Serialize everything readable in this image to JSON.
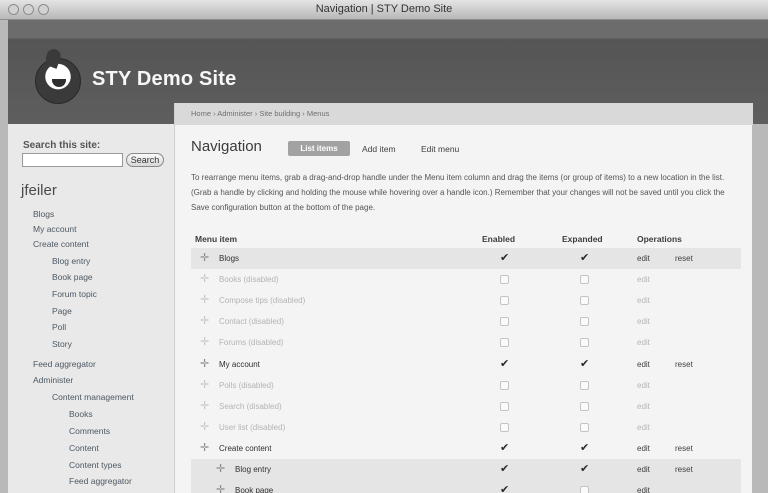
{
  "window": {
    "title": "Navigation | STY Demo Site"
  },
  "header": {
    "site_name": "STY Demo Site"
  },
  "sidebar": {
    "search_label": "Search this site:",
    "search_value": "",
    "search_button": "Search",
    "username": "jfeiler",
    "links": [
      "Blogs",
      "My account",
      "Create content",
      "Blog entry",
      "Book page",
      "Forum topic",
      "Page",
      "Poll",
      "Story",
      "Feed aggregator",
      "Administer",
      "Content management",
      "Books",
      "Comments",
      "Content",
      "Content types",
      "Feed aggregator"
    ]
  },
  "main": {
    "breadcrumb": "Home › Administer › Site building › Menus",
    "title": "Navigation",
    "tabs": [
      "List items",
      "Add item",
      "Edit menu"
    ],
    "description": "To rearrange menu items, grab a drag-and-drop handle under the Menu item column and drag the items (or group of items) to a new location in the list. (Grab a handle by clicking and holding the mouse while hovering over a handle icon.) Remember that your changes will not be saved until you click the Save configuration button at the bottom of the page.",
    "columns": [
      "Menu item",
      "Enabled",
      "Expanded",
      "Operations"
    ],
    "rows": [
      {
        "label": "Blogs",
        "enabled": true,
        "expanded": true,
        "edit": "edit",
        "reset": "reset"
      },
      {
        "label": "Books (disabled)",
        "enabled": false,
        "expanded": false,
        "edit": "edit",
        "reset": ""
      },
      {
        "label": "Compose tips (disabled)",
        "enabled": false,
        "expanded": false,
        "edit": "edit",
        "reset": ""
      },
      {
        "label": "Contact (disabled)",
        "enabled": false,
        "expanded": false,
        "edit": "edit",
        "reset": ""
      },
      {
        "label": "Forums (disabled)",
        "enabled": false,
        "expanded": false,
        "edit": "edit",
        "reset": ""
      },
      {
        "label": "My account",
        "enabled": true,
        "expanded": true,
        "edit": "edit",
        "reset": "reset"
      },
      {
        "label": "Polls (disabled)",
        "enabled": false,
        "expanded": false,
        "edit": "edit",
        "reset": ""
      },
      {
        "label": "Search (disabled)",
        "enabled": false,
        "expanded": false,
        "edit": "edit",
        "reset": ""
      },
      {
        "label": "User list (disabled)",
        "enabled": false,
        "expanded": false,
        "edit": "edit",
        "reset": ""
      },
      {
        "label": "Create content",
        "enabled": true,
        "expanded": true,
        "edit": "edit",
        "reset": "reset"
      },
      {
        "label": "Blog entry",
        "enabled": true,
        "expanded": true,
        "edit": "edit",
        "reset": "reset"
      },
      {
        "label": "Book page",
        "enabled": true,
        "expanded": false,
        "edit": "edit",
        "reset": ""
      }
    ]
  }
}
